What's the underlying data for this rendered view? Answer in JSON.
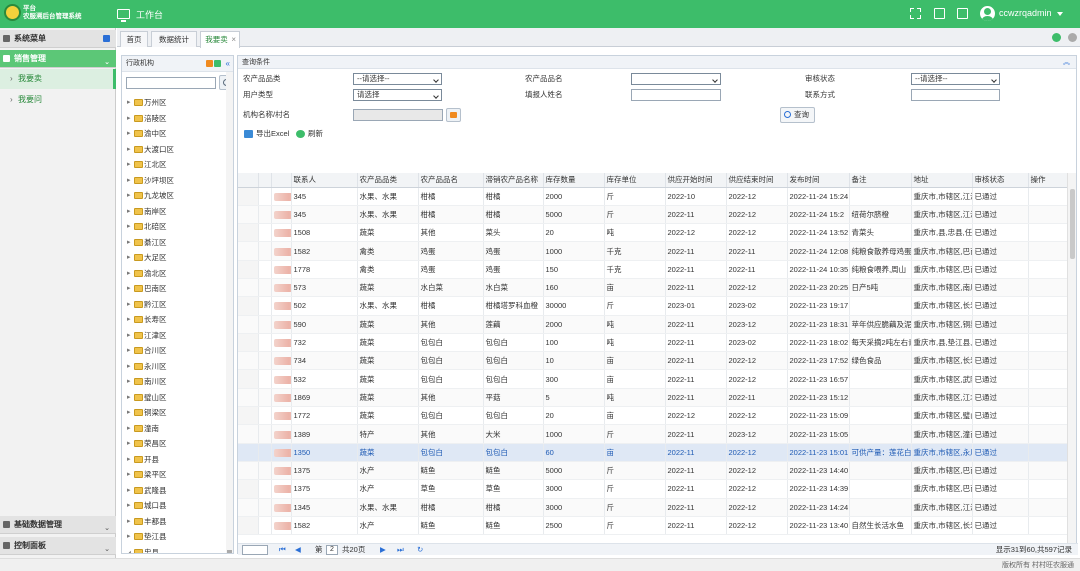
{
  "brand": {
    "line1": "平台",
    "line2": "农服溯后台管理系统"
  },
  "header": {
    "workspace": "工作台",
    "username": "ccwzrqadmin"
  },
  "sidebar": {
    "sections": [
      "系统菜单",
      "销售管理",
      "基础数据管理",
      "控制面板"
    ],
    "items": [
      "我要卖",
      "我要问"
    ]
  },
  "tabs": [
    "首页",
    "数据统计",
    "我要卖"
  ],
  "tree": {
    "title": "行政机构",
    "nodes": [
      "万州区",
      "涪陵区",
      "渝中区",
      "大渡口区",
      "江北区",
      "沙坪坝区",
      "九龙坡区",
      "南岸区",
      "北碚区",
      "綦江区",
      "大足区",
      "渝北区",
      "巴南区",
      "黔江区",
      "长寿区",
      "江津区",
      "合川区",
      "永川区",
      "南川区",
      "璧山区",
      "铜梁区",
      "潼南",
      "荣昌区",
      "开县",
      "梁平区",
      "武隆县",
      "城口县",
      "丰都县",
      "垫江县",
      "忠县"
    ]
  },
  "query": {
    "title": "查询条件",
    "fields": {
      "product_category": {
        "label": "农产品品类",
        "value": "--请选择--"
      },
      "product_name": {
        "label": "农产品品名",
        "value": ""
      },
      "review_status": {
        "label": "审核状态",
        "value": "--请选择--"
      },
      "user_type": {
        "label": "用户类型",
        "value": "请选择"
      },
      "filler_name": {
        "label": "填报人姓名"
      },
      "contact": {
        "label": "联系方式"
      },
      "org_village": {
        "label": "机构名称/村名"
      }
    },
    "search_label": "查询"
  },
  "toolbar": {
    "export": "导出Excel",
    "refresh": "刷新"
  },
  "table": {
    "columns": [
      "联系人",
      "农产品品类",
      "农产品品名",
      "滞销农产品名称",
      "库存数量",
      "库存单位",
      "供应开始时间",
      "供应结束时间",
      "发布时间",
      "备注",
      "地址",
      "审核状态",
      "操作"
    ],
    "rows": [
      {
        "contact": "345",
        "cat": "水果、水果",
        "name": "柑橘",
        "slow": "柑橘",
        "qty": "2000",
        "unit": "斤",
        "start": "2022-10",
        "end": "2022-12",
        "pub": "2022-11-24 15:24",
        "note": "",
        "addr": "重庆市,市辖区,江津区,慈云镇",
        "status": "已通过"
      },
      {
        "contact": "345",
        "cat": "水果、水果",
        "name": "柑橘",
        "slow": "柑橘",
        "qty": "5000",
        "unit": "斤",
        "start": "2022-11",
        "end": "2022-12",
        "pub": "2022-11-24 15:2",
        "note": "纽荷尔脐橙",
        "addr": "重庆市,市辖区,江津区,慈云镇",
        "status": "已通过"
      },
      {
        "contact": "1508",
        "cat": "蔬菜",
        "name": "其他",
        "slow": "菜头",
        "qty": "20",
        "unit": "吨",
        "start": "2022-12",
        "end": "2022-12",
        "pub": "2022-11-24 13:52",
        "note": "青菜头",
        "addr": "重庆市,县,忠县,任家镇,任家村",
        "status": "已通过"
      },
      {
        "contact": "1582",
        "cat": "禽类",
        "name": "鸡蛋",
        "slow": "鸡蛋",
        "qty": "1000",
        "unit": "千克",
        "start": "2022-11",
        "end": "2022-11",
        "pub": "2022-11-24 12:08",
        "note": "纯粮食散养母鸡蛋",
        "addr": "重庆市,市辖区,巴南区,一品街",
        "status": "已通过"
      },
      {
        "contact": "1778",
        "cat": "禽类",
        "name": "鸡蛋",
        "slow": "鸡蛋",
        "qty": "150",
        "unit": "千克",
        "start": "2022-11",
        "end": "2022-11",
        "pub": "2022-11-24 10:35",
        "note": "纯粮食喂养,周山",
        "addr": "重庆市,市辖区,巴南区,一品街",
        "status": "已通过"
      },
      {
        "contact": "573",
        "cat": "蔬菜",
        "name": "水白菜",
        "slow": "水白菜",
        "qty": "160",
        "unit": "亩",
        "start": "2022-11",
        "end": "2022-12",
        "pub": "2022-11-23 20:25",
        "note": "日产5吨",
        "addr": "重庆市,市辖区,南川区,南城街",
        "status": "已通过"
      },
      {
        "contact": "502",
        "cat": "水果、水果",
        "name": "柑橘",
        "slow": "柑橘塔罗科血橙",
        "qty": "30000",
        "unit": "斤",
        "start": "2023-01",
        "end": "2023-02",
        "pub": "2022-11-23 19:17",
        "note": "",
        "addr": "重庆市,市辖区,长寿区,石堰镇",
        "status": "已通过"
      },
      {
        "contact": "590",
        "cat": "蔬菜",
        "name": "其他",
        "slow": "莲藕",
        "qty": "2000",
        "unit": "吨",
        "start": "2022-11",
        "end": "2023-12",
        "pub": "2022-11-23 18:31",
        "note": "苹年供应脆藕及泥藕",
        "addr": "重庆市,市辖区,铜梁区,平滩镇",
        "status": "已通过"
      },
      {
        "contact": "732",
        "cat": "蔬菜",
        "name": "包包白",
        "slow": "包包白",
        "qty": "100",
        "unit": "吨",
        "start": "2022-11",
        "end": "2023-02",
        "pub": "2022-11-23 18:02",
        "note": "每天采摘2吨左右青",
        "addr": "重庆市,县,垫江县,长龙镇,长久",
        "status": "已通过"
      },
      {
        "contact": "734",
        "cat": "蔬菜",
        "name": "包包白",
        "slow": "包包白",
        "qty": "10",
        "unit": "亩",
        "start": "2022-11",
        "end": "2022-12",
        "pub": "2022-11-23 17:52",
        "note": "绿色食品",
        "addr": "重庆市,市辖区,长寿区,云台镇",
        "status": "已通过"
      },
      {
        "contact": "532",
        "cat": "蔬菜",
        "name": "包包白",
        "slow": "包包白",
        "qty": "300",
        "unit": "亩",
        "start": "2022-11",
        "end": "2022-12",
        "pub": "2022-11-23 16:57",
        "note": "",
        "addr": "重庆市,市辖区,武隆区,黄莺乡",
        "status": "已通过"
      },
      {
        "contact": "1869",
        "cat": "蔬菜",
        "name": "其他",
        "slow": "平菇",
        "qty": "5",
        "unit": "吨",
        "start": "2022-11",
        "end": "2022-11",
        "pub": "2022-11-23 15:12",
        "note": "",
        "addr": "重庆市,市辖区,江北区,广兴镇",
        "status": "已通过"
      },
      {
        "contact": "1772",
        "cat": "蔬菜",
        "name": "包包白",
        "slow": "包包白",
        "qty": "20",
        "unit": "亩",
        "start": "2022-12",
        "end": "2022-12",
        "pub": "2022-11-23 15:09",
        "note": "",
        "addr": "重庆市,市辖区,璧山区,八塘镇",
        "status": "已通过"
      },
      {
        "contact": "1389",
        "cat": "特产",
        "name": "其他",
        "slow": "大米",
        "qty": "1000",
        "unit": "斤",
        "start": "2022-11",
        "end": "2023-12",
        "pub": "2022-11-23 15:05",
        "note": "",
        "addr": "重庆市,市辖区,潼南区,龙形镇",
        "status": "已通过"
      },
      {
        "contact": "1350",
        "cat": "蔬菜",
        "name": "包包白",
        "slow": "包包白",
        "qty": "60",
        "unit": "亩",
        "start": "2022-11",
        "end": "2022-12",
        "pub": "2022-11-23 15:01",
        "note": "可供产量：莲花白",
        "addr": "重庆市,市辖区,永川区,青峰镇",
        "status": "已通过",
        "hl": true
      },
      {
        "contact": "1375",
        "cat": "水产",
        "name": "鲢鱼",
        "slow": "鲢鱼",
        "qty": "5000",
        "unit": "斤",
        "start": "2022-11",
        "end": "2022-12",
        "pub": "2022-11-23 14:40",
        "note": "",
        "addr": "重庆市,市辖区,巴南区,麻柳镇",
        "status": "已通过"
      },
      {
        "contact": "1375",
        "cat": "水产",
        "name": "草鱼",
        "slow": "草鱼",
        "qty": "3000",
        "unit": "斤",
        "start": "2022-11",
        "end": "2022-12",
        "pub": "2022-11-23 14:39",
        "note": "",
        "addr": "重庆市,市辖区,巴南区,麻柳镇",
        "status": "已通过"
      },
      {
        "contact": "1345",
        "cat": "水果、水果",
        "name": "柑橘",
        "slow": "柑橘",
        "qty": "3000",
        "unit": "斤",
        "start": "2022-11",
        "end": "2022-12",
        "pub": "2022-11-23 14:24",
        "note": "",
        "addr": "重庆市,市辖区,江津区,慈云镇",
        "status": "已通过"
      },
      {
        "contact": "1582",
        "cat": "水产",
        "name": "鲢鱼",
        "slow": "鲢鱼",
        "qty": "2500",
        "unit": "斤",
        "start": "2022-11",
        "end": "2022-12",
        "pub": "2022-11-23 13:40",
        "note": "自然生长活水鱼",
        "addr": "重庆市,市辖区,长寿区,云台镇",
        "status": "已通过"
      }
    ]
  },
  "pager": {
    "page_prefix": "第",
    "page_value": "2",
    "page_suffix": "共20页",
    "summary": "显示31到60,共597记录"
  },
  "footer": {
    "text": "版权所有 村村旺农服通"
  }
}
